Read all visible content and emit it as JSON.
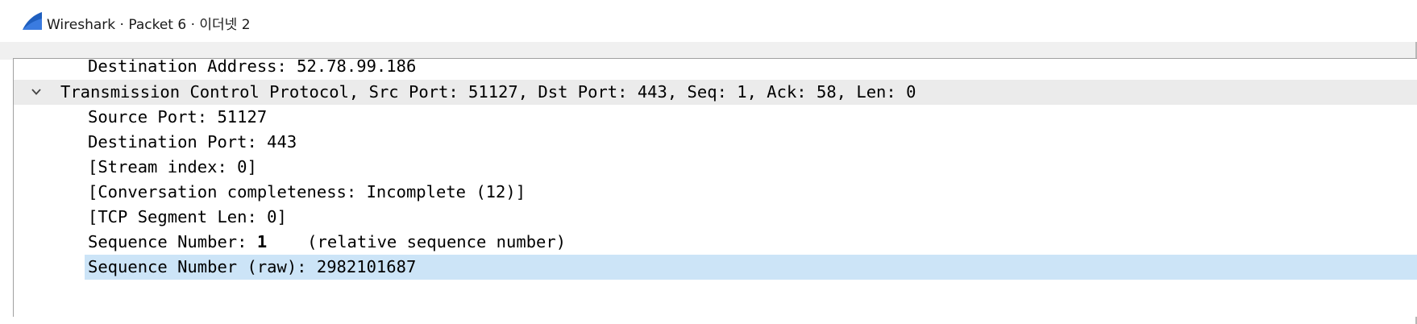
{
  "window": {
    "title": "Wireshark · Packet 6 · 이더넷 2",
    "icon": "wireshark-fin-icon"
  },
  "tree": {
    "rows": [
      {
        "text": "Destination Address: 52.78.99.186"
      },
      {
        "text": "Transmission Control Protocol, Src Port: 51127, Dst Port: 443, Seq: 1, Ack: 58, Len: 0",
        "expanded": true
      },
      {
        "text": "Source Port: 51127"
      },
      {
        "text": "Destination Port: 443"
      },
      {
        "text": "[Stream index: 0]"
      },
      {
        "text": "[Conversation completeness: Incomplete (12)]"
      },
      {
        "text": "[TCP Segment Len: 0]"
      },
      {
        "label": "Sequence Number: ",
        "value": "1",
        "note": "(relative sequence number)"
      },
      {
        "text": "Sequence Number (raw): 2982101687",
        "selected": true
      }
    ]
  },
  "colors": {
    "selection": "#cce4f7",
    "header_row": "#ebebeb",
    "icon_blue": "#1f5fbf"
  }
}
